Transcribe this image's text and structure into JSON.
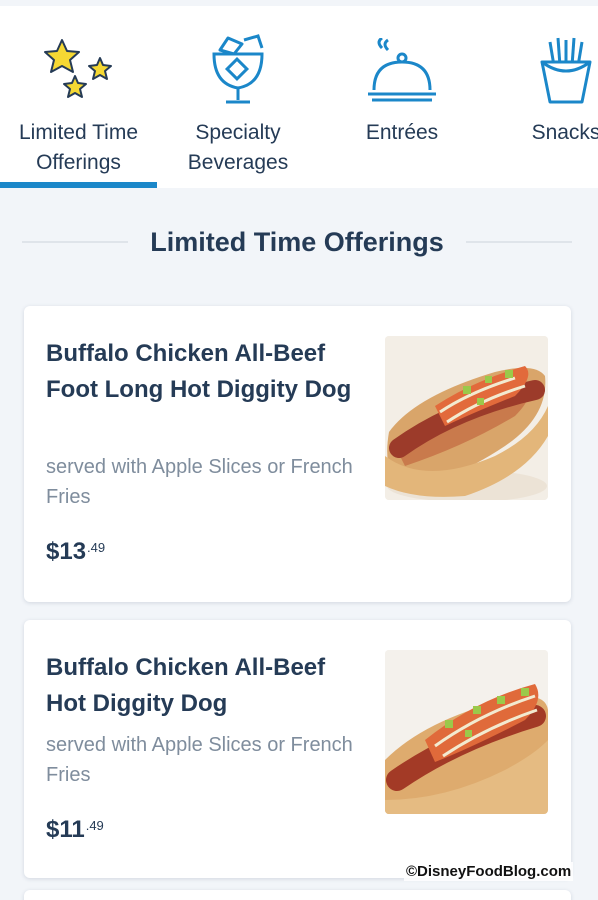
{
  "tabs": [
    {
      "label": "Limited Time\nOfferings",
      "icon": "stars-icon",
      "selected": true
    },
    {
      "label": "Specialty\nBeverages",
      "icon": "specialty-drink-icon",
      "selected": false
    },
    {
      "label": "Entrées",
      "icon": "cloche-icon",
      "selected": false
    },
    {
      "label": "Snacks",
      "icon": "fries-icon",
      "selected": false
    }
  ],
  "section": {
    "title": "Limited Time Offerings"
  },
  "items": [
    {
      "name": "Buffalo Chicken All-Beef Foot Long Hot Diggity Dog",
      "description": "served with Apple Slices or French Fries",
      "price_dollars": "$13",
      "price_cents": ".49",
      "image": "hot-dog-photo"
    },
    {
      "name": "Buffalo Chicken All-Beef Hot Diggity Dog",
      "description": "served with Apple Slices or French Fries",
      "price_dollars": "$11",
      "price_cents": ".49",
      "image": "hot-dog-photo"
    }
  ],
  "watermark": "©DisneyFoodBlog.com",
  "colors": {
    "accent": "#1b87c9",
    "text": "#253b56",
    "muted": "#7f8d9d",
    "star": "#f5d833"
  }
}
